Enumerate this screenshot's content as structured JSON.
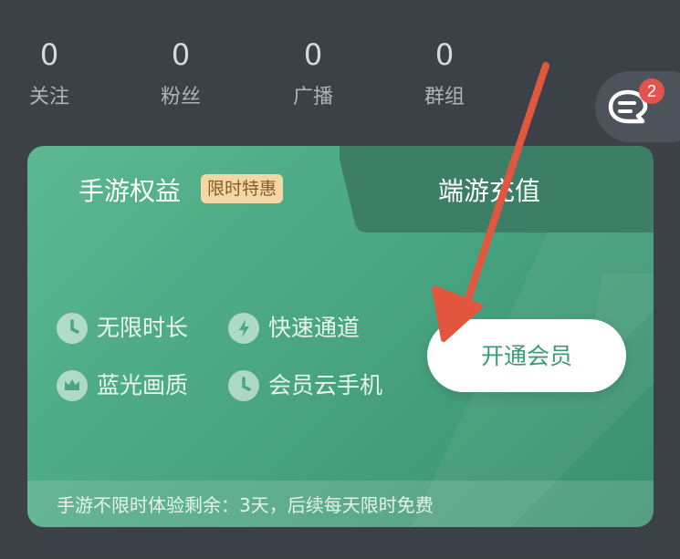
{
  "stats": [
    {
      "value": "0",
      "label": "关注"
    },
    {
      "value": "0",
      "label": "粉丝"
    },
    {
      "value": "0",
      "label": "广播"
    },
    {
      "value": "0",
      "label": "群组"
    }
  ],
  "messages": {
    "badge_count": "2",
    "icon": "chat-icon"
  },
  "tabs": {
    "active": {
      "label": "手游权益",
      "badge": "限时特惠"
    },
    "inactive": {
      "label": "端游充值"
    }
  },
  "features": [
    {
      "label": "无限时长",
      "icon": "clock-icon"
    },
    {
      "label": "快速通道",
      "icon": "lightning-icon"
    },
    {
      "label": "蓝光画质",
      "icon": "crown-icon"
    },
    {
      "label": "会员云手机",
      "icon": "phone-icon"
    }
  ],
  "cta": {
    "label": "开通会员"
  },
  "footer": {
    "text": "手游不限时体验剩余：3天，后续每天限时免费"
  },
  "colors": {
    "background": "#3c4147",
    "card_green": "#4aa683",
    "promo_badge": "#f5d7a5",
    "arrow_annotation": "#e2553f",
    "notification_badge": "#e0544d"
  },
  "annotation": {
    "type": "red-arrow",
    "points_to": "开通会员"
  }
}
